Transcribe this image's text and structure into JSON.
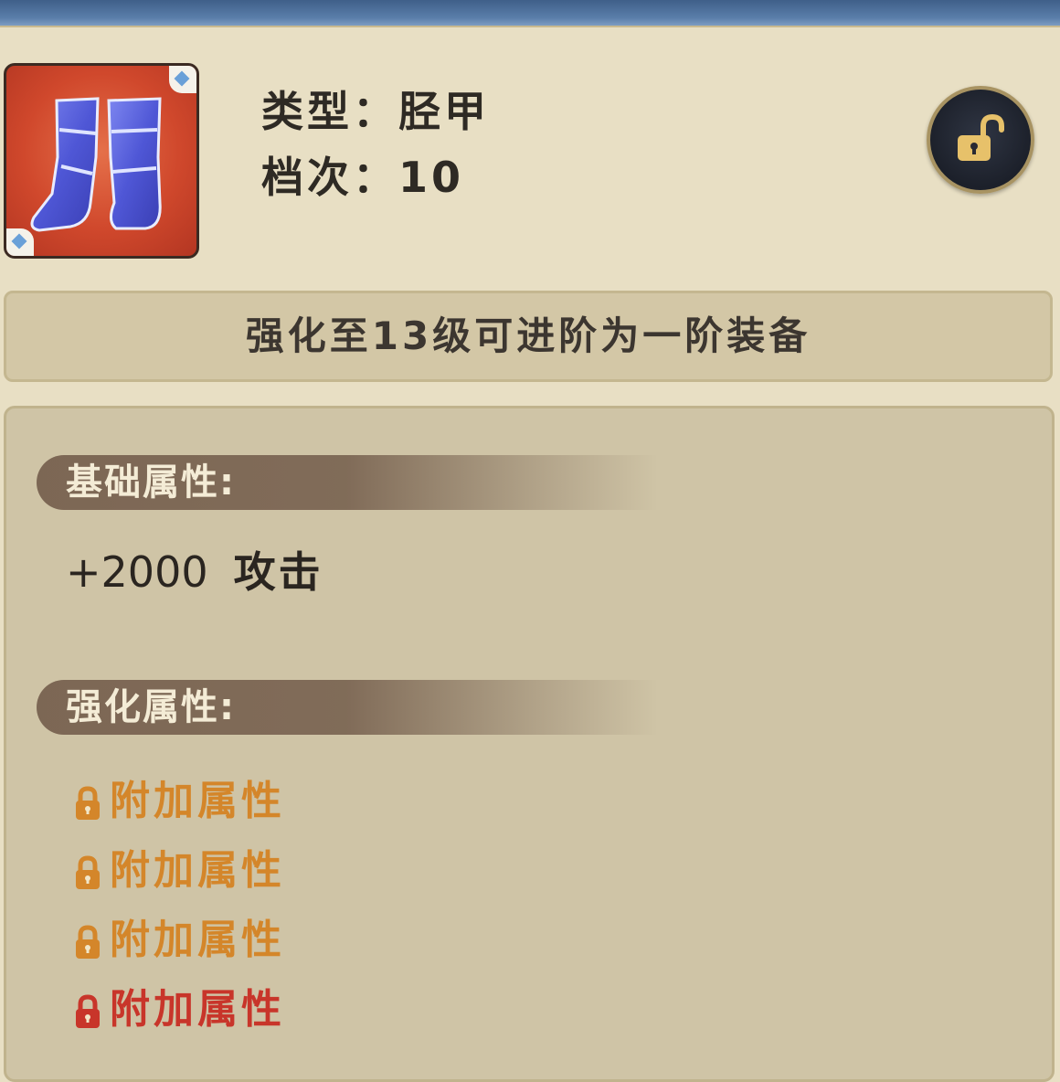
{
  "header": {
    "title": ""
  },
  "item": {
    "type_label": "类型：",
    "type_value": "胫甲",
    "grade_label": "档次：",
    "grade_value": "10",
    "icon_name": "boots-icon"
  },
  "lock_button": {
    "icon": "unlock-icon"
  },
  "upgrade_tip": "强化至13级可进阶为一阶装备",
  "basic_attributes": {
    "title": "基础属性:",
    "stats": [
      {
        "value": "+2000",
        "name": "攻击"
      }
    ]
  },
  "enhance_attributes": {
    "title": "强化属性:",
    "items": [
      {
        "label": "附加属性",
        "color": "#d4862a"
      },
      {
        "label": "附加属性",
        "color": "#d4862a"
      },
      {
        "label": "附加属性",
        "color": "#d4862a"
      },
      {
        "label": "附加属性",
        "color": "#c8352a"
      }
    ]
  }
}
